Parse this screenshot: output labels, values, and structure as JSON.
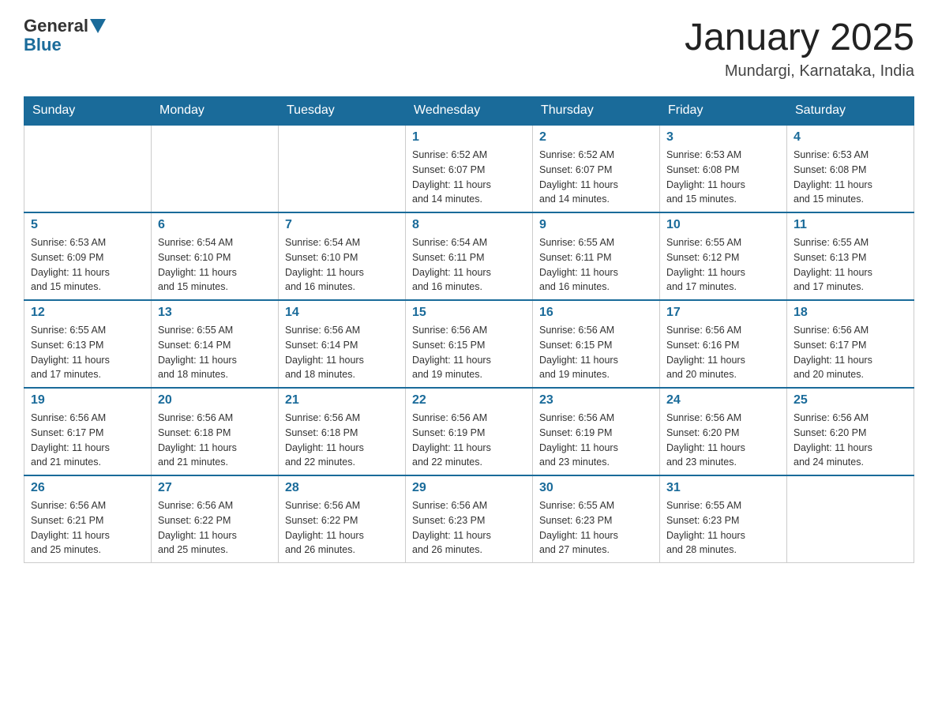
{
  "header": {
    "logo_general": "General",
    "logo_blue": "Blue",
    "month_title": "January 2025",
    "location": "Mundargi, Karnataka, India"
  },
  "days_of_week": [
    "Sunday",
    "Monday",
    "Tuesday",
    "Wednesday",
    "Thursday",
    "Friday",
    "Saturday"
  ],
  "weeks": [
    [
      {
        "day": "",
        "info": ""
      },
      {
        "day": "",
        "info": ""
      },
      {
        "day": "",
        "info": ""
      },
      {
        "day": "1",
        "info": "Sunrise: 6:52 AM\nSunset: 6:07 PM\nDaylight: 11 hours\nand 14 minutes."
      },
      {
        "day": "2",
        "info": "Sunrise: 6:52 AM\nSunset: 6:07 PM\nDaylight: 11 hours\nand 14 minutes."
      },
      {
        "day": "3",
        "info": "Sunrise: 6:53 AM\nSunset: 6:08 PM\nDaylight: 11 hours\nand 15 minutes."
      },
      {
        "day": "4",
        "info": "Sunrise: 6:53 AM\nSunset: 6:08 PM\nDaylight: 11 hours\nand 15 minutes."
      }
    ],
    [
      {
        "day": "5",
        "info": "Sunrise: 6:53 AM\nSunset: 6:09 PM\nDaylight: 11 hours\nand 15 minutes."
      },
      {
        "day": "6",
        "info": "Sunrise: 6:54 AM\nSunset: 6:10 PM\nDaylight: 11 hours\nand 15 minutes."
      },
      {
        "day": "7",
        "info": "Sunrise: 6:54 AM\nSunset: 6:10 PM\nDaylight: 11 hours\nand 16 minutes."
      },
      {
        "day": "8",
        "info": "Sunrise: 6:54 AM\nSunset: 6:11 PM\nDaylight: 11 hours\nand 16 minutes."
      },
      {
        "day": "9",
        "info": "Sunrise: 6:55 AM\nSunset: 6:11 PM\nDaylight: 11 hours\nand 16 minutes."
      },
      {
        "day": "10",
        "info": "Sunrise: 6:55 AM\nSunset: 6:12 PM\nDaylight: 11 hours\nand 17 minutes."
      },
      {
        "day": "11",
        "info": "Sunrise: 6:55 AM\nSunset: 6:13 PM\nDaylight: 11 hours\nand 17 minutes."
      }
    ],
    [
      {
        "day": "12",
        "info": "Sunrise: 6:55 AM\nSunset: 6:13 PM\nDaylight: 11 hours\nand 17 minutes."
      },
      {
        "day": "13",
        "info": "Sunrise: 6:55 AM\nSunset: 6:14 PM\nDaylight: 11 hours\nand 18 minutes."
      },
      {
        "day": "14",
        "info": "Sunrise: 6:56 AM\nSunset: 6:14 PM\nDaylight: 11 hours\nand 18 minutes."
      },
      {
        "day": "15",
        "info": "Sunrise: 6:56 AM\nSunset: 6:15 PM\nDaylight: 11 hours\nand 19 minutes."
      },
      {
        "day": "16",
        "info": "Sunrise: 6:56 AM\nSunset: 6:15 PM\nDaylight: 11 hours\nand 19 minutes."
      },
      {
        "day": "17",
        "info": "Sunrise: 6:56 AM\nSunset: 6:16 PM\nDaylight: 11 hours\nand 20 minutes."
      },
      {
        "day": "18",
        "info": "Sunrise: 6:56 AM\nSunset: 6:17 PM\nDaylight: 11 hours\nand 20 minutes."
      }
    ],
    [
      {
        "day": "19",
        "info": "Sunrise: 6:56 AM\nSunset: 6:17 PM\nDaylight: 11 hours\nand 21 minutes."
      },
      {
        "day": "20",
        "info": "Sunrise: 6:56 AM\nSunset: 6:18 PM\nDaylight: 11 hours\nand 21 minutes."
      },
      {
        "day": "21",
        "info": "Sunrise: 6:56 AM\nSunset: 6:18 PM\nDaylight: 11 hours\nand 22 minutes."
      },
      {
        "day": "22",
        "info": "Sunrise: 6:56 AM\nSunset: 6:19 PM\nDaylight: 11 hours\nand 22 minutes."
      },
      {
        "day": "23",
        "info": "Sunrise: 6:56 AM\nSunset: 6:19 PM\nDaylight: 11 hours\nand 23 minutes."
      },
      {
        "day": "24",
        "info": "Sunrise: 6:56 AM\nSunset: 6:20 PM\nDaylight: 11 hours\nand 23 minutes."
      },
      {
        "day": "25",
        "info": "Sunrise: 6:56 AM\nSunset: 6:20 PM\nDaylight: 11 hours\nand 24 minutes."
      }
    ],
    [
      {
        "day": "26",
        "info": "Sunrise: 6:56 AM\nSunset: 6:21 PM\nDaylight: 11 hours\nand 25 minutes."
      },
      {
        "day": "27",
        "info": "Sunrise: 6:56 AM\nSunset: 6:22 PM\nDaylight: 11 hours\nand 25 minutes."
      },
      {
        "day": "28",
        "info": "Sunrise: 6:56 AM\nSunset: 6:22 PM\nDaylight: 11 hours\nand 26 minutes."
      },
      {
        "day": "29",
        "info": "Sunrise: 6:56 AM\nSunset: 6:23 PM\nDaylight: 11 hours\nand 26 minutes."
      },
      {
        "day": "30",
        "info": "Sunrise: 6:55 AM\nSunset: 6:23 PM\nDaylight: 11 hours\nand 27 minutes."
      },
      {
        "day": "31",
        "info": "Sunrise: 6:55 AM\nSunset: 6:23 PM\nDaylight: 11 hours\nand 28 minutes."
      },
      {
        "day": "",
        "info": ""
      }
    ]
  ]
}
